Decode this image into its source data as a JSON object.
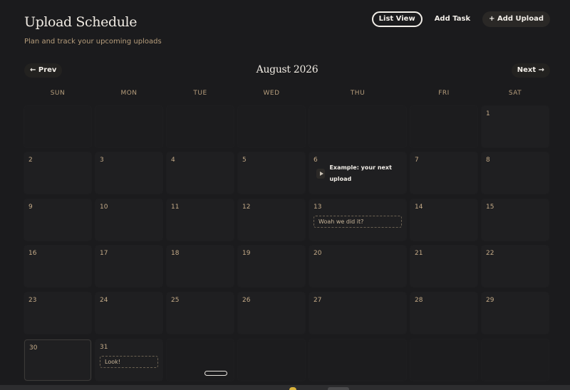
{
  "header": {
    "title": "Upload Schedule",
    "subtitle": "Plan and track your upcoming uploads",
    "list_view_label": "List View",
    "add_task_label": "Add Task",
    "add_upload_label": "+ Add Upload"
  },
  "nav": {
    "prev_label": "← Prev",
    "month_label": "August 2026",
    "next_label": "Next →"
  },
  "weekdays": [
    "SUN",
    "MON",
    "TUE",
    "WED",
    "THU",
    "FRI",
    "SAT"
  ],
  "weeks": [
    [
      null,
      null,
      null,
      null,
      null,
      null,
      "1"
    ],
    [
      "2",
      "3",
      "4",
      "5",
      "6",
      "7",
      "8"
    ],
    [
      "9",
      "10",
      "11",
      "12",
      "13",
      "14",
      "15"
    ],
    [
      "16",
      "17",
      "18",
      "19",
      "20",
      "21",
      "22"
    ],
    [
      "23",
      "24",
      "25",
      "26",
      "27",
      "28",
      "29"
    ],
    [
      "30",
      "31",
      null,
      null,
      null,
      null,
      null
    ]
  ],
  "today": "30",
  "events": [
    {
      "day": "6",
      "kind": "upload",
      "icon": "play-icon",
      "label": "Example: your next upload"
    },
    {
      "day": "13",
      "kind": "task",
      "label": "Woah we did it?"
    },
    {
      "day": "31",
      "kind": "task",
      "label": "Look!"
    }
  ],
  "colors": {
    "background": "#1b1b1d",
    "cell": "#1f1f21",
    "accent_text": "#c5ab88",
    "weekday_text": "#b79e7c"
  }
}
